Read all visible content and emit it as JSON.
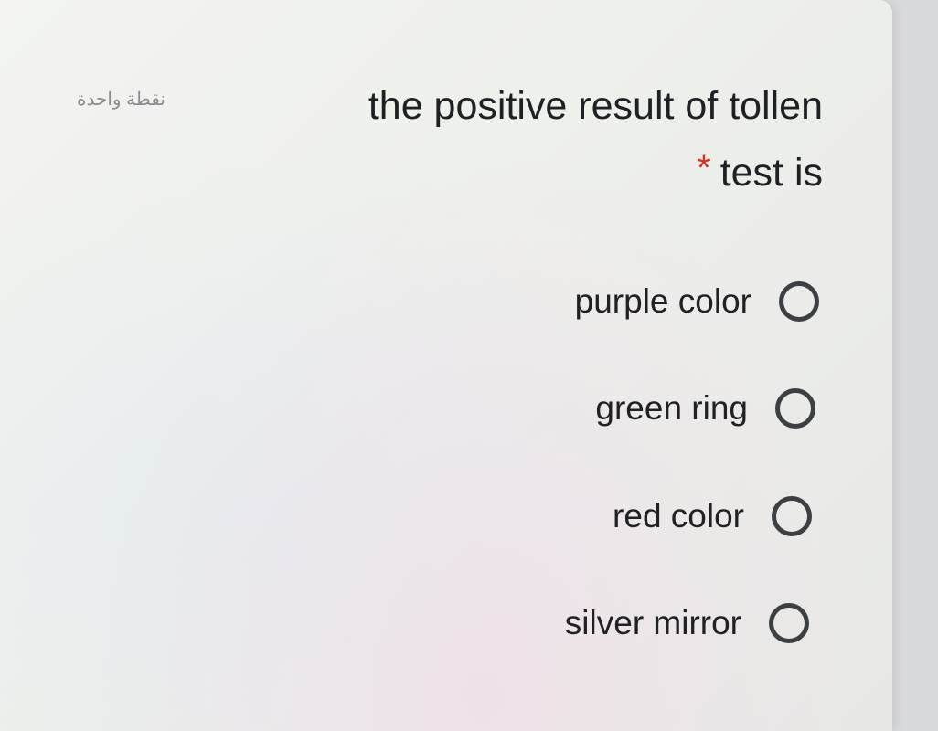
{
  "question": {
    "points": "نقطة واحدة",
    "text_line1": "the positive result of tollen",
    "required_mark": "*",
    "text_line2": "test is"
  },
  "options": [
    {
      "label": "purple color",
      "selected": false
    },
    {
      "label": "green ring",
      "selected": false
    },
    {
      "label": "red color",
      "selected": false
    },
    {
      "label": "silver mirror",
      "selected": false
    }
  ],
  "colors": {
    "required": "#d93025",
    "text": "#202124",
    "radio_border": "#3c4043"
  }
}
